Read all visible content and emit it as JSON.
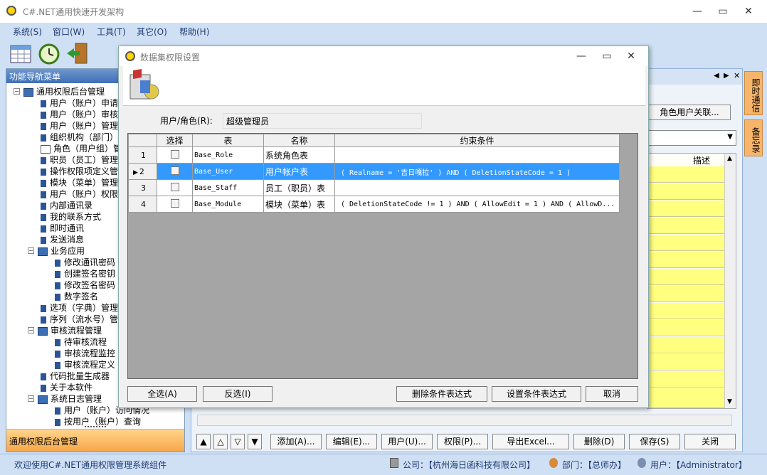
{
  "window": {
    "title": "C#.NET通用快速开发架构",
    "minimize": "—",
    "maximize": "▭",
    "close": "✕"
  },
  "menu": [
    "系统(S)",
    "窗口(W)",
    "工具(T)",
    "其它(O)",
    "帮助(H)"
  ],
  "toolbar_icons": [
    "database-grid-icon",
    "clock-refresh-icon",
    "exit-door-icon"
  ],
  "nav": {
    "header": "功能导航菜单",
    "bottom_label": "通用权限后台管理",
    "tree": [
      {
        "label": "通用权限后台管理",
        "level": 0,
        "type": "folder",
        "expanded": true
      },
      {
        "label": "用户（账户）申请",
        "level": 1,
        "type": "leaf"
      },
      {
        "label": "用户（账户）审核",
        "level": 1,
        "type": "leaf"
      },
      {
        "label": "用户（账户）管理",
        "level": 1,
        "type": "leaf"
      },
      {
        "label": "组织机构（部门）",
        "level": 1,
        "type": "leaf"
      },
      {
        "label": "角色（用户组）管",
        "level": 1,
        "type": "book"
      },
      {
        "label": "职员（员工）管理",
        "level": 1,
        "type": "leaf"
      },
      {
        "label": "操作权限项定义管",
        "level": 1,
        "type": "leaf"
      },
      {
        "label": "模块（菜单）管理",
        "level": 1,
        "type": "leaf"
      },
      {
        "label": "用户（账户）权限",
        "level": 1,
        "type": "leaf"
      },
      {
        "label": "内部通讯录",
        "level": 1,
        "type": "leaf"
      },
      {
        "label": "我的联系方式",
        "level": 1,
        "type": "leaf"
      },
      {
        "label": "即时通讯",
        "level": 1,
        "type": "leaf"
      },
      {
        "label": "发送消息",
        "level": 1,
        "type": "leaf"
      },
      {
        "label": "业务应用",
        "level": 1,
        "type": "folder",
        "expanded": true
      },
      {
        "label": "修改通讯密码",
        "level": 2,
        "type": "leaf"
      },
      {
        "label": "创建签名密钥",
        "level": 2,
        "type": "leaf"
      },
      {
        "label": "修改签名密码",
        "level": 2,
        "type": "leaf"
      },
      {
        "label": "数字签名",
        "level": 2,
        "type": "leaf"
      },
      {
        "label": "选项（字典）管理",
        "level": 1,
        "type": "leaf"
      },
      {
        "label": "序列（流水号）管",
        "level": 1,
        "type": "leaf"
      },
      {
        "label": "审核流程管理",
        "level": 1,
        "type": "folder",
        "expanded": true
      },
      {
        "label": "待审核流程",
        "level": 2,
        "type": "leaf"
      },
      {
        "label": "审核流程监控",
        "level": 2,
        "type": "leaf"
      },
      {
        "label": "审核流程定义",
        "level": 2,
        "type": "leaf"
      },
      {
        "label": "代码批量生成器",
        "level": 1,
        "type": "leaf"
      },
      {
        "label": "关于本软件",
        "level": 1,
        "type": "leaf"
      },
      {
        "label": "系统日志管理",
        "level": 1,
        "type": "folder",
        "expanded": true
      },
      {
        "label": "用户（账户）访问情况",
        "level": 2,
        "type": "leaf"
      },
      {
        "label": "按用户（账户）查询",
        "level": 2,
        "type": "leaf"
      }
    ]
  },
  "right_panel": {
    "role_user_button": "角色用户关联...",
    "grid_header": "描述",
    "bottom_buttons": [
      "添加(A)...",
      "编辑(E)...",
      "用户(U)...",
      "权限(P)...",
      "导出Excel...",
      "删除(D)",
      "保存(S)",
      "关闭"
    ],
    "nav_arrows": [
      "▲",
      "△",
      "▽",
      "▼"
    ]
  },
  "side_tabs": [
    "即时通信",
    "备忘录"
  ],
  "status": {
    "welcome": "欢迎使用C#.NET通用权限管理系统组件",
    "company": "公司：【杭州海日函科技有限公司】",
    "department": "部门：【总师办】",
    "user": "用户：【Administrator】"
  },
  "dialog": {
    "title": "数据集权限设置",
    "user_role_label": "用户/角色(R):",
    "user_role_value": "超级管理员",
    "columns": [
      "选择",
      "表",
      "名称",
      "约束条件"
    ],
    "rows": [
      {
        "num": "1",
        "checked": false,
        "table": "Base_Role",
        "name": "系统角色表",
        "constraint": "",
        "selected": false
      },
      {
        "num": "2",
        "checked": false,
        "table": "Base_User",
        "name": "用户帐户表",
        "constraint": "( Realname = '吉日嘎拉' ) AND ( DeletionStateCode = 1 )",
        "selected": true
      },
      {
        "num": "3",
        "checked": false,
        "table": "Base_Staff",
        "name": "员工（职员）表",
        "constraint": "",
        "selected": false
      },
      {
        "num": "4",
        "checked": false,
        "table": "Base_Module",
        "name": "模块（菜单）表",
        "constraint": "( DeletionStateCode != 1 ) AND ( AllowEdit = 1 ) AND ( AllowD...",
        "selected": false
      }
    ],
    "buttons": {
      "select_all": "全选(A)",
      "invert": "反选(I)",
      "delete_expr": "删除条件表达式",
      "set_expr": "设置条件表达式",
      "cancel": "取消"
    }
  }
}
